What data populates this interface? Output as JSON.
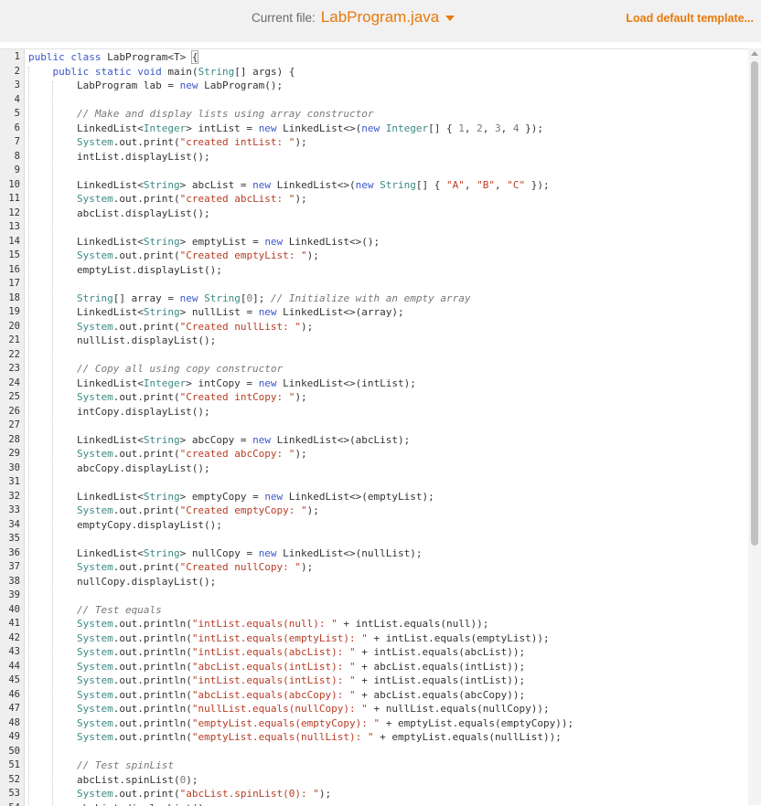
{
  "header": {
    "current_file_label": "Current file:",
    "current_file_name": "LabProgram.java",
    "load_default": "Load default template..."
  },
  "editor": {
    "lines": [
      "public class LabProgram<T> {",
      "    public static void main(String[] args) {",
      "        LabProgram lab = new LabProgram();",
      "",
      "        // Make and display lists using array constructor",
      "        LinkedList<Integer> intList = new LinkedList<>(new Integer[] { 1, 2, 3, 4 });",
      "        System.out.print(\"created intList: \");",
      "        intList.displayList();",
      "",
      "        LinkedList<String> abcList = new LinkedList<>(new String[] { \"A\", \"B\", \"C\" });",
      "        System.out.print(\"created abcList: \");",
      "        abcList.displayList();",
      "",
      "        LinkedList<String> emptyList = new LinkedList<>();",
      "        System.out.print(\"Created emptyList: \");",
      "        emptyList.displayList();",
      "",
      "        String[] array = new String[0]; // Initialize with an empty array",
      "        LinkedList<String> nullList = new LinkedList<>(array);",
      "        System.out.print(\"Created nullList: \");",
      "        nullList.displayList();",
      "",
      "        // Copy all using copy constructor",
      "        LinkedList<Integer> intCopy = new LinkedList<>(intList);",
      "        System.out.print(\"Created intCopy: \");",
      "        intCopy.displayList();",
      "",
      "        LinkedList<String> abcCopy = new LinkedList<>(abcList);",
      "        System.out.print(\"created abcCopy: \");",
      "        abcCopy.displayList();",
      "",
      "        LinkedList<String> emptyCopy = new LinkedList<>(emptyList);",
      "        System.out.print(\"Created emptyCopy: \");",
      "        emptyCopy.displayList();",
      "",
      "        LinkedList<String> nullCopy = new LinkedList<>(nullList);",
      "        System.out.print(\"Created nullCopy: \");",
      "        nullCopy.displayList();",
      "",
      "        // Test equals",
      "        System.out.println(\"intList.equals(null): \" + intList.equals(null));",
      "        System.out.println(\"intList.equals(emptyList): \" + intList.equals(emptyList));",
      "        System.out.println(\"intList.equals(abcList): \" + intList.equals(abcList));",
      "        System.out.println(\"abcList.equals(intList): \" + abcList.equals(intList));",
      "        System.out.println(\"intList.equals(intList): \" + intList.equals(intList));",
      "        System.out.println(\"abcList.equals(abcCopy): \" + abcList.equals(abcCopy));",
      "        System.out.println(\"nullList.equals(nullCopy): \" + nullList.equals(nullCopy));",
      "        System.out.println(\"emptyList.equals(emptyCopy): \" + emptyList.equals(emptyCopy));",
      "        System.out.println(\"emptyList.equals(nullList): \" + emptyList.equals(nullList));",
      "",
      "        // Test spinList",
      "        abcList.spinList(0);",
      "        System.out.print(\"abcList.spinList(0): \");",
      "        abcList.displayList();"
    ]
  }
}
